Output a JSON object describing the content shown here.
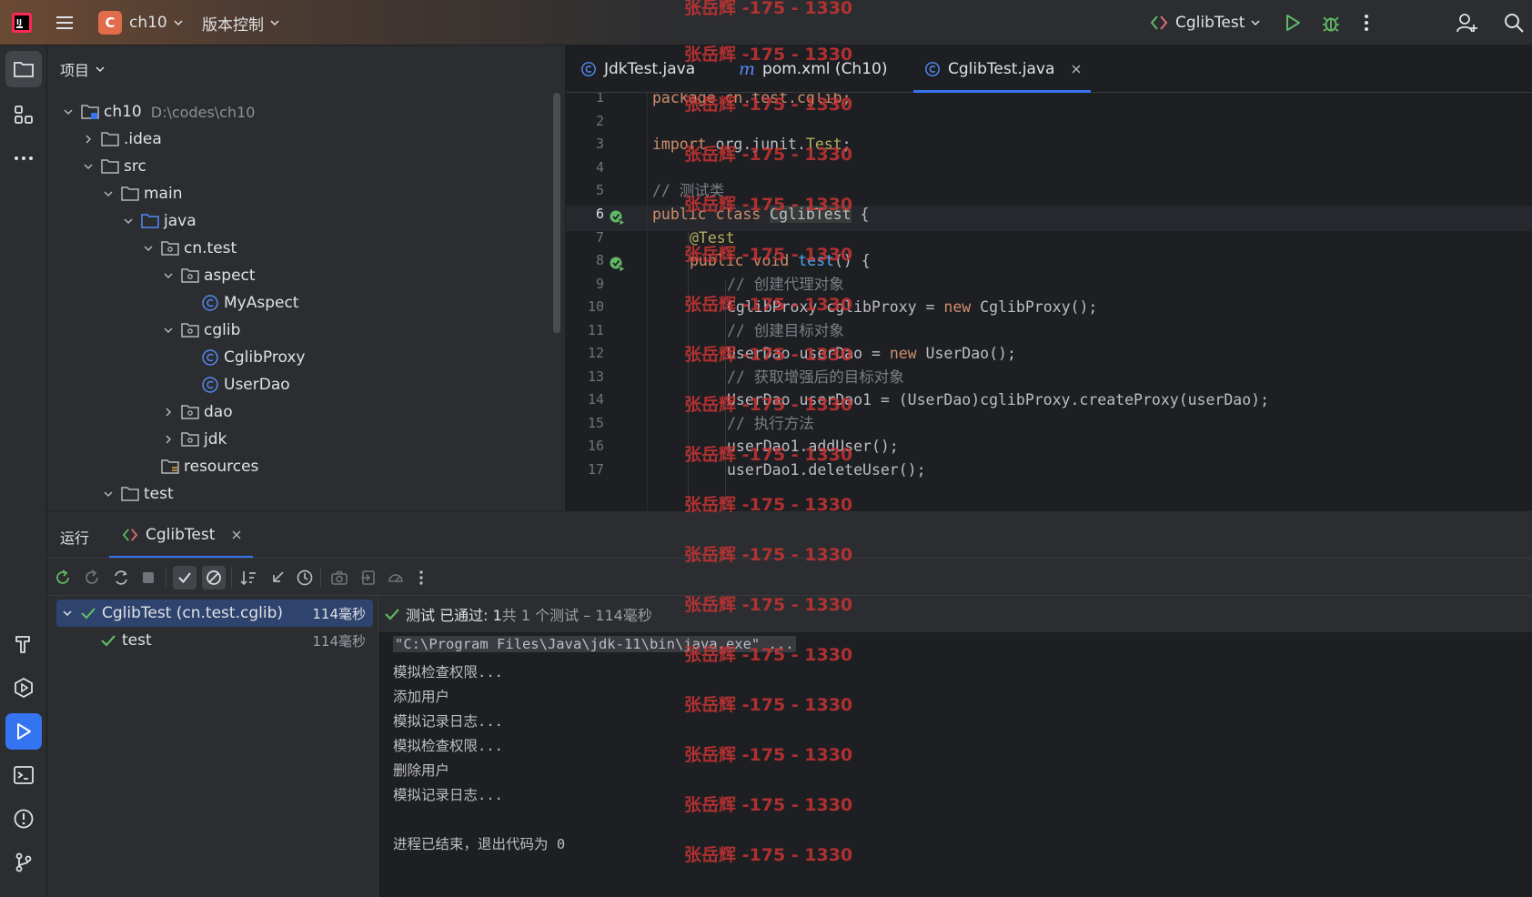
{
  "titlebar": {
    "project_badge": "C",
    "project_name": "ch10",
    "vcs_menu": "版本控制",
    "run_config": "CglibTest"
  },
  "project_panel": {
    "title": "项目",
    "tree": [
      {
        "label": "ch10",
        "hint": "D:\\codes\\ch10"
      },
      {
        "label": ".idea"
      },
      {
        "label": "src"
      },
      {
        "label": "main"
      },
      {
        "label": "java"
      },
      {
        "label": "cn.test"
      },
      {
        "label": "aspect"
      },
      {
        "label": "MyAspect"
      },
      {
        "label": "cglib"
      },
      {
        "label": "CglibProxy"
      },
      {
        "label": "UserDao"
      },
      {
        "label": "dao"
      },
      {
        "label": "jdk"
      },
      {
        "label": "resources"
      },
      {
        "label": "test"
      }
    ]
  },
  "editor": {
    "tabs": [
      {
        "label": "JdkTest.java"
      },
      {
        "label": "pom.xml (Ch10)"
      },
      {
        "label": "CglibTest.java"
      }
    ],
    "line_numbers": [
      "1",
      "2",
      "3",
      "4",
      "5",
      "6",
      "7",
      "8",
      "9",
      "10",
      "11",
      "12",
      "13",
      "14",
      "15",
      "16",
      "17"
    ],
    "lines": {
      "l1": "package cn.test.cglib;",
      "l3a": "import ",
      "l3b": "org.junit.",
      "l3c": "Test",
      "l3d": ";",
      "l5": "// 测试类",
      "l6a": "public class ",
      "l6b": "CglibTest",
      "l6c": " {",
      "l7": "@Test",
      "l8a": "public void ",
      "l8b": "test",
      "l8c": "() {",
      "l9": "// 创建代理对象",
      "l10a": "CglibProxy cglibProxy = ",
      "l10b": "new",
      "l10c": " CglibProxy();",
      "l11": "// 创建目标对象",
      "l12a": "UserDao userDao = ",
      "l12b": "new",
      "l12c": " UserDao();",
      "l13": "// 获取增强后的目标对象",
      "l14": "UserDao userDao1 = (UserDao)cglibProxy.createProxy(userDao);",
      "l15": "// 执行方法",
      "l16": "userDao1.addUser();",
      "l17": "userDao1.deleteUser();"
    }
  },
  "run_panel": {
    "title": "运行",
    "tab_label": "CglibTest",
    "test_tree": [
      {
        "label": "CglibTest (cn.test.cglib)",
        "duration": "114毫秒"
      },
      {
        "label": "test",
        "duration": "114毫秒"
      }
    ],
    "status_prefix": "测试 已通过: 1",
    "status_suffix": "共 1 个测试 – 114毫秒",
    "console": [
      "\"C:\\Program Files\\Java\\jdk-11\\bin\\java.exe\" ...",
      "模拟检查权限...",
      "添加用户",
      "模拟记录日志...",
      "模拟检查权限...",
      "删除用户",
      "模拟记录日志...",
      "",
      "进程已结束，退出代码为 0"
    ]
  },
  "watermark": "张岳辉 -175 - 1330",
  "colors": {
    "accent": "#3574f0",
    "success": "#5fb865",
    "watermark": "#c93434"
  }
}
